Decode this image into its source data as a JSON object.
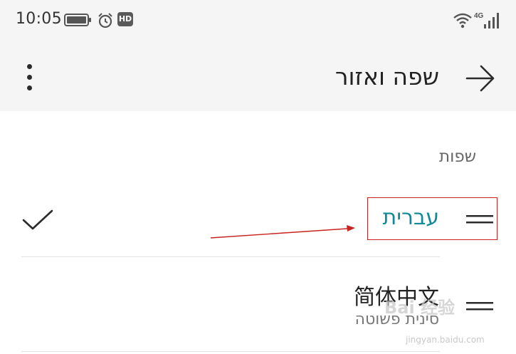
{
  "status_bar": {
    "time": "10:05",
    "hd_badge": "HD",
    "network_type": "4G",
    "icons": [
      "battery-icon",
      "alarm-icon",
      "hd-icon",
      "wifi-icon",
      "signal-icon"
    ]
  },
  "toolbar": {
    "title": "שפה ואזור",
    "back_icon": "arrow-right-icon",
    "menu_icon": "more-vertical-icon"
  },
  "section": {
    "header": "שפות"
  },
  "languages": [
    {
      "name": "עברית",
      "selected": true,
      "icon": "check-icon",
      "handle_icon": "drag-handle-icon"
    },
    {
      "name": "简体中文",
      "subtitle": "סינית פשוטה",
      "selected": false,
      "handle_icon": "drag-handle-icon"
    }
  ],
  "watermark": {
    "text": "Bai 经验",
    "url": "jingyan.baidu.com"
  },
  "colors": {
    "topbar_bg": "#f5f5f5",
    "accent": "#108a9a",
    "annotation": "#c8231e",
    "divider": "#e3e3e3"
  }
}
